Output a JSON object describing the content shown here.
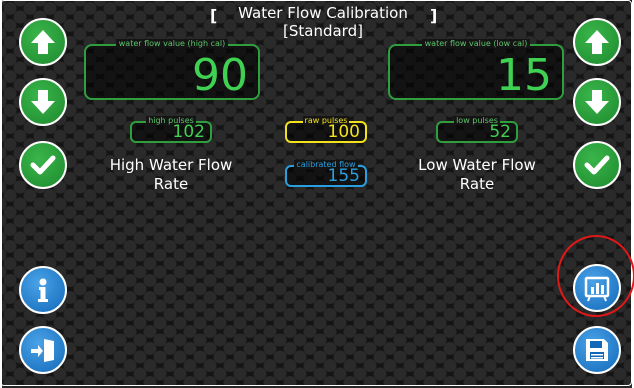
{
  "title": {
    "line1": "Water Flow Calibration",
    "line2": "[Standard]",
    "bracket_left": "[",
    "bracket_right": "]"
  },
  "high_cal": {
    "caption": "water flow value (high cal)",
    "value": "90",
    "pulses_caption": "high pulses",
    "pulses_value": "102",
    "rate_label": "High Water Flow Rate"
  },
  "low_cal": {
    "caption": "water flow value (low cal)",
    "value": "15",
    "pulses_caption": "low pulses",
    "pulses_value": "52",
    "rate_label": "Low Water Flow Rate"
  },
  "raw": {
    "caption": "raw pulses",
    "value": "100"
  },
  "calibrated": {
    "caption": "calibrated flow",
    "value": "155"
  },
  "colors": {
    "green_accent": "#3fd152",
    "yellow_accent": "#f2e21b",
    "blue_accent": "#2a9fe0",
    "highlight": "#e01818"
  },
  "icons": {
    "left": [
      "arrow-up-icon",
      "arrow-down-icon",
      "check-icon",
      "info-icon",
      "exit-door-icon"
    ],
    "right": [
      "arrow-up-icon",
      "arrow-down-icon",
      "check-icon",
      "chart-icon",
      "save-icon"
    ]
  }
}
